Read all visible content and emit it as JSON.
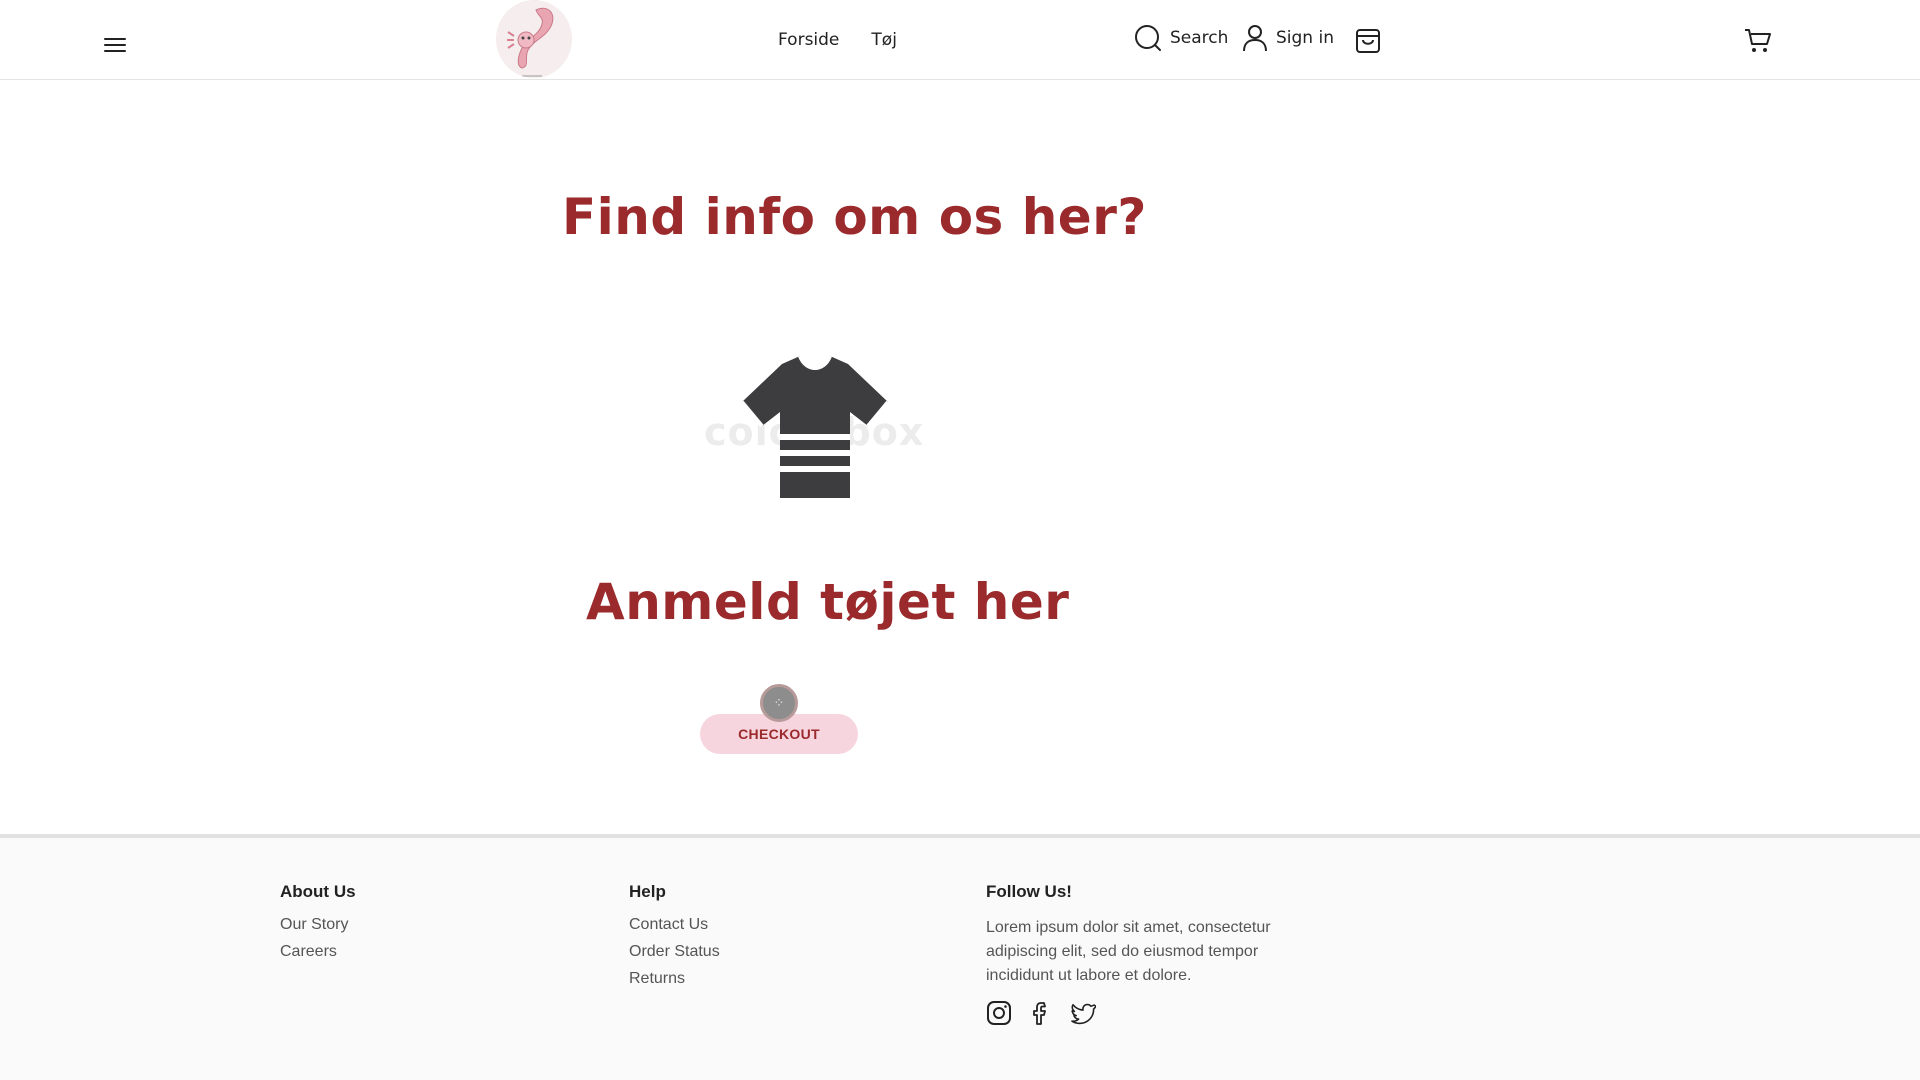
{
  "header": {
    "nav": [
      "Forside",
      "Tøj"
    ],
    "search_label": "Search",
    "signin_label": "Sign in"
  },
  "main": {
    "title": "Find info om os her?",
    "watermark": "colourbox",
    "review_title": "Anmeld tøjet her",
    "checkout_label": "CHECKOUT"
  },
  "footer": {
    "about": {
      "heading": "About Us",
      "links": [
        "Our Story",
        "Careers"
      ]
    },
    "help": {
      "heading": "Help",
      "links": [
        "Contact Us",
        "Order Status",
        "Returns"
      ]
    },
    "follow": {
      "heading": "Follow Us!",
      "text": "Lorem ipsum dolor sit amet, consectetur adipiscing elit, sed do eiusmod tempor incididunt ut labore et dolore.",
      "icons": [
        "instagram-icon",
        "facebook-icon",
        "twitter-icon"
      ]
    }
  },
  "colors": {
    "accent": "#9b2a2c",
    "button_bg": "#f7d5de"
  }
}
